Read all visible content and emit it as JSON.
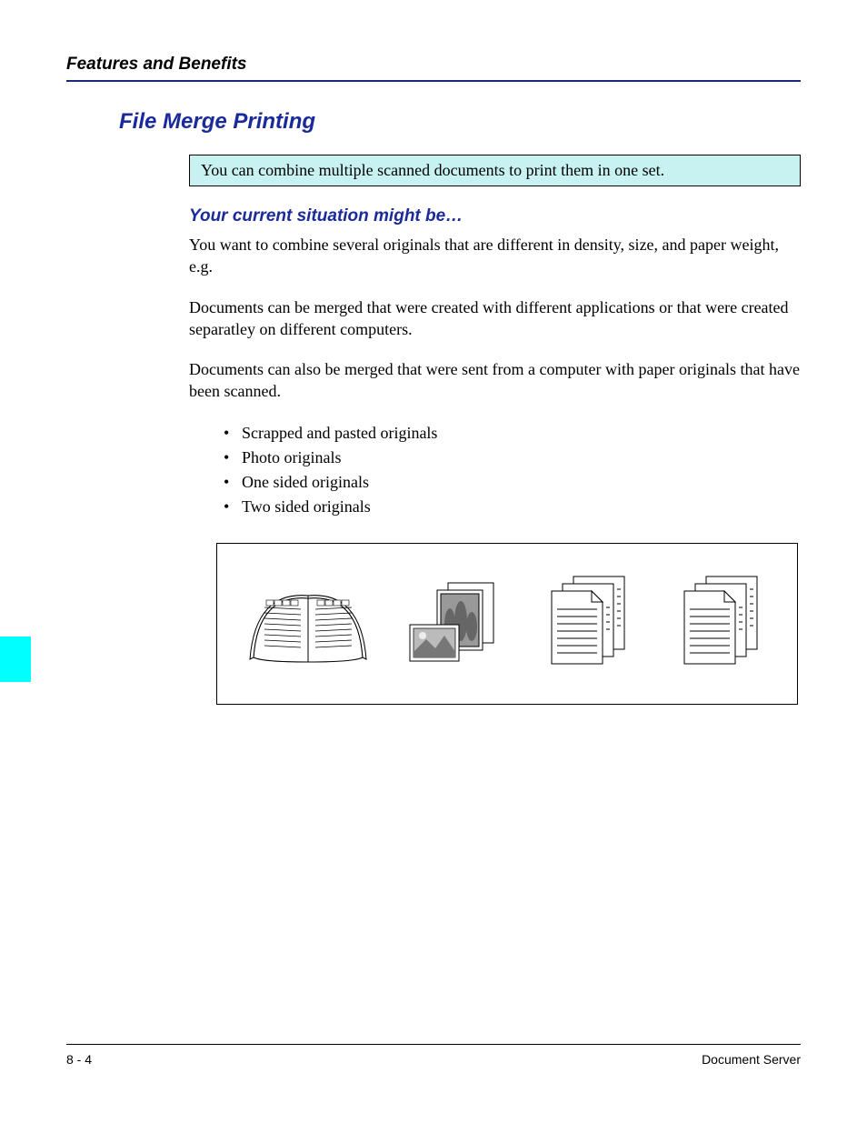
{
  "header": {
    "title": "Features and Benefits"
  },
  "section": {
    "title": "File Merge Printing"
  },
  "infobox": {
    "text": "You can combine multiple scanned documents to print them in one set."
  },
  "subheading": {
    "text": "Your current situation might be…"
  },
  "paragraphs": {
    "p1": "You want to combine several originals that are different in density, size, and paper weight, e.g.",
    "p2": "Documents can be merged that were created with different applications or that were created separatley on different computers.",
    "p3": "Documents can also be merged that were sent from a computer with paper originals that have been scanned."
  },
  "bullets": {
    "b1": "Scrapped and pasted originals",
    "b2": "Photo originals",
    "b3": "One sided originals",
    "b4": "Two sided originals"
  },
  "footer": {
    "page": "8 - 4",
    "label": "Document Server"
  }
}
